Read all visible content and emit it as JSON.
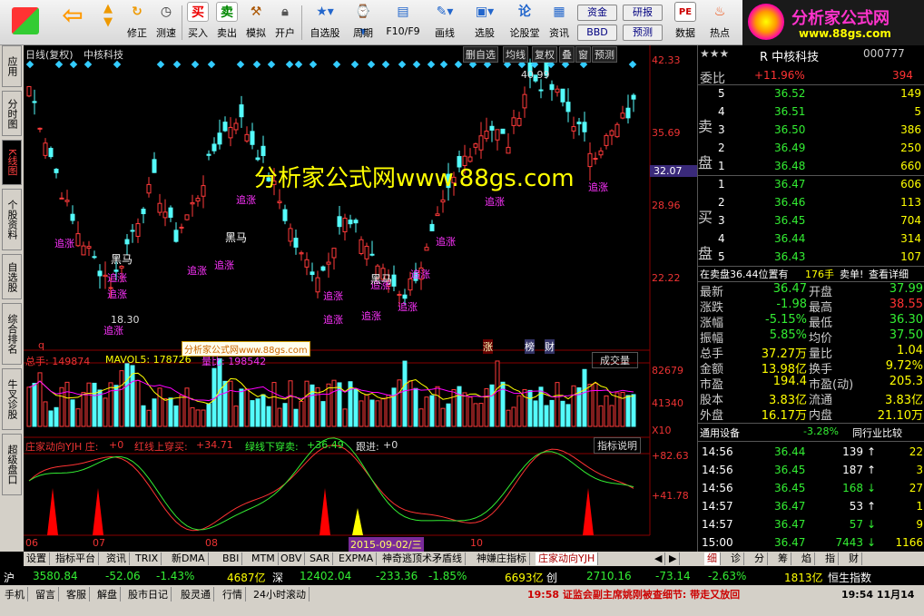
{
  "toolbar": {
    "buttons": [
      "修正",
      "测速",
      "买入",
      "卖出",
      "模拟",
      "开户",
      "自选股",
      "周期",
      "F10/F9",
      "画线",
      "选股",
      "论股堂",
      "资讯",
      "数据",
      "热点"
    ],
    "fund": "资金",
    "bbd": "BBD",
    "research": "研报",
    "forecast": "预测"
  },
  "logo": {
    "text": "分析家公式网",
    "url": "www.88gs.com"
  },
  "sidebar": [
    "应用",
    "分时图",
    "K线图",
    "个股资料",
    "自选股",
    "综合排名",
    "牛叉诊股",
    "超级盘口"
  ],
  "chart": {
    "title": "日线(复权)",
    "stock": "中核科技",
    "tools": [
      "删自选",
      "均线",
      "复权",
      "叠",
      "窗",
      "预测"
    ],
    "watermark": "分析家公式网www.88gs.com",
    "small_wm": "分析家公式网www.88gs.com",
    "price_ticks": [
      "42.33",
      "35.69",
      "28.96",
      "22.22"
    ],
    "current_price": "32.07",
    "high_label": "40.99",
    "low_label": "18.30",
    "tags": {
      "zhui": "追涨",
      "heima": "黑马"
    },
    "vol_header": {
      "total": "总手: 149874",
      "mavol": "MAVOL5: 178726",
      "ratio": "量比: 198542",
      "mode": "成交量"
    },
    "vol_ticks": [
      "82679",
      "41340",
      "X10"
    ],
    "ind_header": {
      "name": "庄家动向YJH 庄:",
      "v1": "+0",
      "red": "红线上穿买:",
      "v2": "+34.71",
      "green": "绿线下穿卖:",
      "v3": "+36.49",
      "follow": "跟进:",
      "v4": "+0",
      "help": "指标说明"
    },
    "ind_ticks": [
      "+82.63",
      "+41.78"
    ],
    "xdates": [
      "06",
      "07",
      "08",
      "10"
    ],
    "sel_date": "2015-09-02/三",
    "marks": [
      "涨",
      "榜",
      "财"
    ]
  },
  "quote": {
    "stars": "★★★",
    "name": "R 中核科技",
    "code": "000777",
    "wb_label": "委比",
    "wb": "+11.96%",
    "wb_v": "394",
    "sell": [
      [
        "5",
        "36.52",
        "149"
      ],
      [
        "4",
        "36.51",
        "5"
      ],
      [
        "3",
        "36.50",
        "386"
      ],
      [
        "2",
        "36.49",
        "250"
      ],
      [
        "1",
        "36.48",
        "660"
      ]
    ],
    "buy": [
      [
        "1",
        "36.47",
        "606"
      ],
      [
        "2",
        "36.46",
        "113"
      ],
      [
        "3",
        "36.45",
        "704"
      ],
      [
        "4",
        "36.44",
        "314"
      ],
      [
        "5",
        "36.43",
        "107"
      ]
    ],
    "sell_label": "卖盘",
    "buy_label": "买盘",
    "info": "在卖盘36.44位置有",
    "info_v": "176手",
    "info_b": "卖单!",
    "info_link": "查看详细",
    "stats": [
      [
        "最新",
        "36.47",
        "开盘",
        "37.99"
      ],
      [
        "涨跌",
        "-1.98",
        "最高",
        "38.55"
      ],
      [
        "涨幅",
        "-5.15%",
        "最低",
        "36.30"
      ],
      [
        "振幅",
        "5.85%",
        "均价",
        "37.50"
      ],
      [
        "总手",
        "37.27万",
        "量比",
        "1.04"
      ],
      [
        "金额",
        "13.98亿",
        "换手",
        "9.72%"
      ],
      [
        "市盈",
        "194.4",
        "市盈(动)",
        "205.3"
      ],
      [
        "股本",
        "3.83亿",
        "流通",
        "3.83亿"
      ],
      [
        "外盘",
        "16.17万",
        "内盘",
        "21.10万"
      ]
    ],
    "industry": "通用设备",
    "ind_pct": "-3.28%",
    "ind_cmp": "同行业比较",
    "ticks": [
      [
        "14:56",
        "36.44",
        "139",
        "↑",
        "22"
      ],
      [
        "14:56",
        "36.45",
        "187",
        "↑",
        "3"
      ],
      [
        "14:56",
        "36.45",
        "168",
        "↓",
        "27"
      ],
      [
        "14:57",
        "36.47",
        "53",
        "↑",
        "1"
      ],
      [
        "14:57",
        "36.47",
        "57",
        "↓",
        "9"
      ],
      [
        "15:00",
        "36.47",
        "7443",
        "↓",
        "1166"
      ]
    ]
  },
  "tabs": [
    "设置",
    "指标平台",
    "资讯",
    "TRIX",
    "新DMA",
    "BBI",
    "MTM",
    "OBV",
    "SAR",
    "EXPMA",
    "神奇逃顶术矛盾线",
    "神嫌庄指标",
    "庄家动向YJH"
  ],
  "rtabs": [
    "细",
    "诊",
    "分",
    "筹",
    "焰",
    "指",
    "财"
  ],
  "ticker": {
    "sh": "沪",
    "sh_v": "3580.84",
    "sh_c": "-52.06",
    "sh_p": "-1.43%",
    "sh_a": "4687亿",
    "sz": "深",
    "sz_v": "12402.04",
    "sz_c": "-233.36",
    "sz_p": "-1.85%",
    "sz_a": "6693亿",
    "cy": "创",
    "cy_v": "2710.16",
    "cy_c": "-73.14",
    "cy_p": "-2.63%",
    "cy_a": "1813亿",
    "hs": "恒生指数"
  },
  "status": {
    "items": [
      "手机",
      "留言",
      "客服",
      "解盘",
      "股市日记",
      "股灵通",
      "行情",
      "24小时滚动"
    ],
    "news": "19:58 证监会副主席姚刚被查细节: 带走又放回",
    "time": "19:54 11月14"
  }
}
